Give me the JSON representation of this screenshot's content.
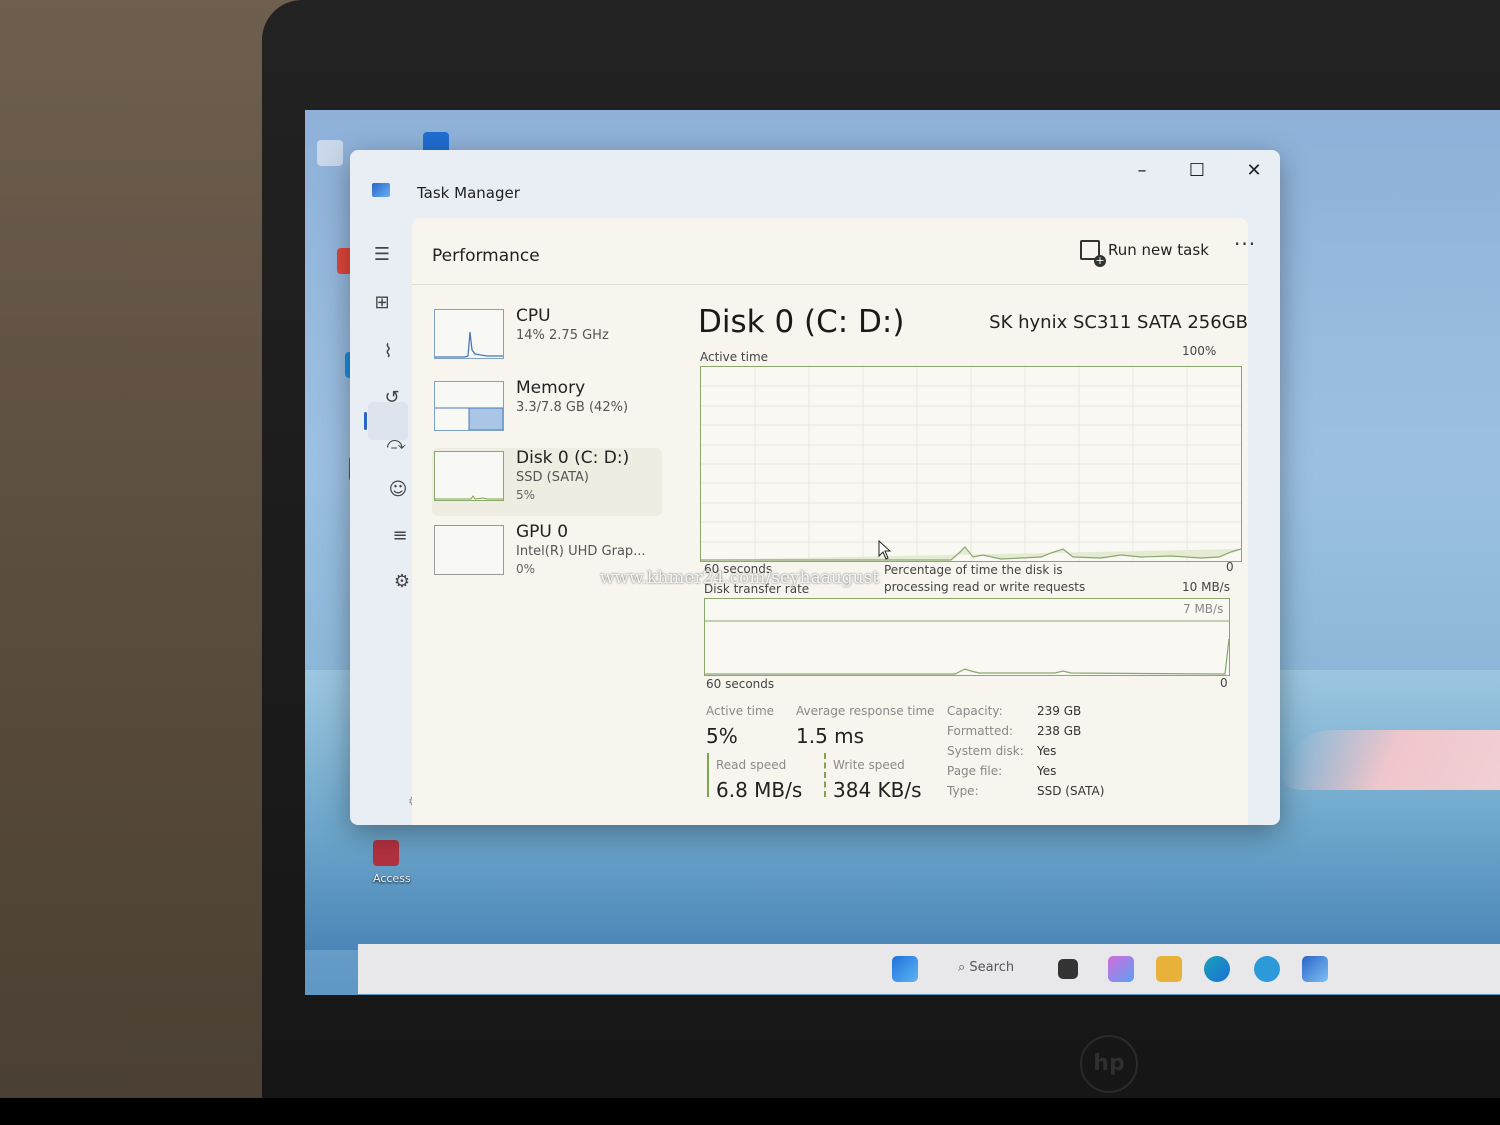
{
  "window": {
    "title": "Task Manager",
    "controls": {
      "minimize": "–",
      "maximize": "☐",
      "close": "✕"
    }
  },
  "header": {
    "page_title": "Performance",
    "run_new_task": "Run new task",
    "more": "···"
  },
  "nav_icons": [
    "hamburger-icon",
    "processes-icon",
    "performance-icon",
    "app-history-icon",
    "startup-icon",
    "users-icon",
    "details-icon",
    "services-icon",
    "settings-icon"
  ],
  "devices": [
    {
      "name": "CPU",
      "sub": "14% 2.75 GHz",
      "sub2": ""
    },
    {
      "name": "Memory",
      "sub": "3.3/7.8 GB (42%)",
      "sub2": ""
    },
    {
      "name": "Disk 0 (C: D:)",
      "sub": "SSD (SATA)",
      "sub2": "5%"
    },
    {
      "name": "GPU 0",
      "sub": "Intel(R) UHD Grap...",
      "sub2": "0%"
    }
  ],
  "disk": {
    "title": "Disk 0 (C: D:)",
    "model": "SK hynix SC311 SATA 256GB",
    "active_time_graph": {
      "label": "Active time",
      "max": "100%",
      "x_label": "60 seconds",
      "min": "0",
      "caption": "Percentage of time the disk is processing read or write requests"
    },
    "transfer_graph": {
      "label": "Disk transfer rate",
      "max": "10 MB/s",
      "line_label": "7 MB/s",
      "x_label": "60 seconds",
      "min": "0"
    },
    "stats": {
      "active_time_label": "Active time",
      "active_time": "5%",
      "avg_response_label": "Average response time",
      "avg_response": "1.5 ms",
      "read_speed_label": "Read speed",
      "read_speed": "6.8 MB/s",
      "write_speed_label": "Write speed",
      "write_speed": "384 KB/s"
    },
    "properties": [
      {
        "key": "Capacity:",
        "value": "239 GB"
      },
      {
        "key": "Formatted:",
        "value": "238 GB"
      },
      {
        "key": "System disk:",
        "value": "Yes"
      },
      {
        "key": "Page file:",
        "value": "Yes"
      },
      {
        "key": "Type:",
        "value": "SSD (SATA)"
      }
    ]
  },
  "taskbar": {
    "search": "Search"
  },
  "desktop": {
    "access": "Access"
  },
  "watermark": "www.khmer24.com/seyhaaugust",
  "colors": {
    "accent": "#2b65c8",
    "graph_line": "#8aa86e",
    "graph_bg": "#f9f8f3"
  }
}
